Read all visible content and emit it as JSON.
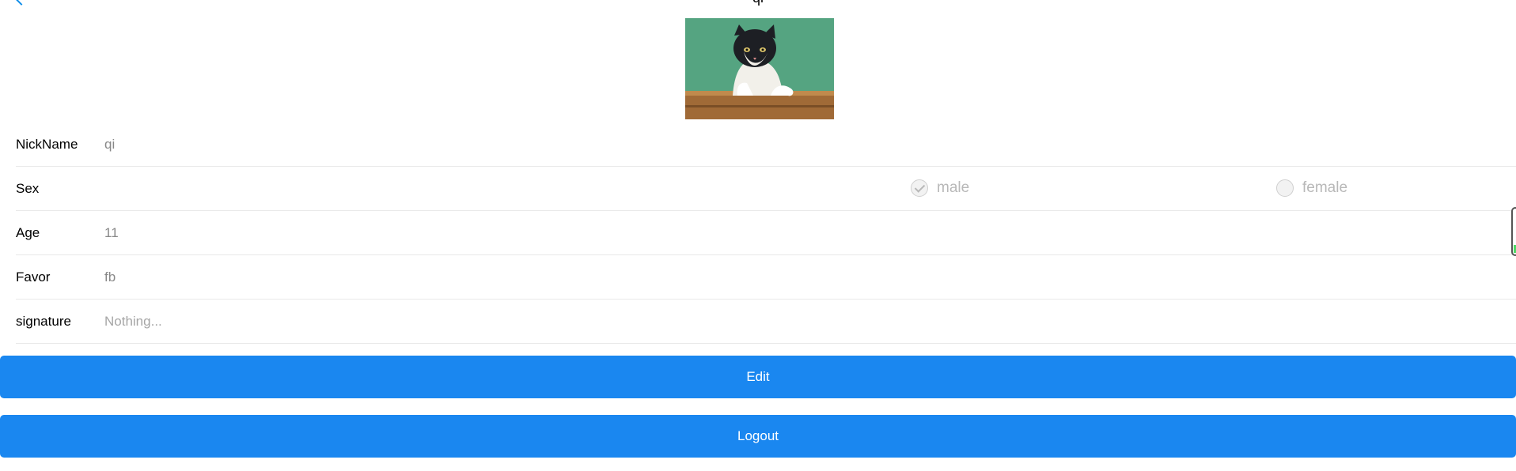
{
  "header": {
    "title": "qi",
    "back_icon": "chevron-left-icon"
  },
  "avatar": {
    "description_icon": "cat-photo"
  },
  "form": {
    "nickname": {
      "label": "NickName",
      "value": "qi"
    },
    "sex": {
      "label": "Sex",
      "options": [
        {
          "label": "male",
          "checked": true
        },
        {
          "label": "female",
          "checked": false
        }
      ]
    },
    "age": {
      "label": "Age",
      "value": "11"
    },
    "favor": {
      "label": "Favor",
      "value": "fb"
    },
    "signature": {
      "label": "signature",
      "placeholder": "Nothing..."
    }
  },
  "buttons": {
    "edit": "Edit",
    "logout": "Logout"
  },
  "colors": {
    "primary": "#1a87f0",
    "back_icon": "#108ee9",
    "divider": "#e9e9e9"
  }
}
